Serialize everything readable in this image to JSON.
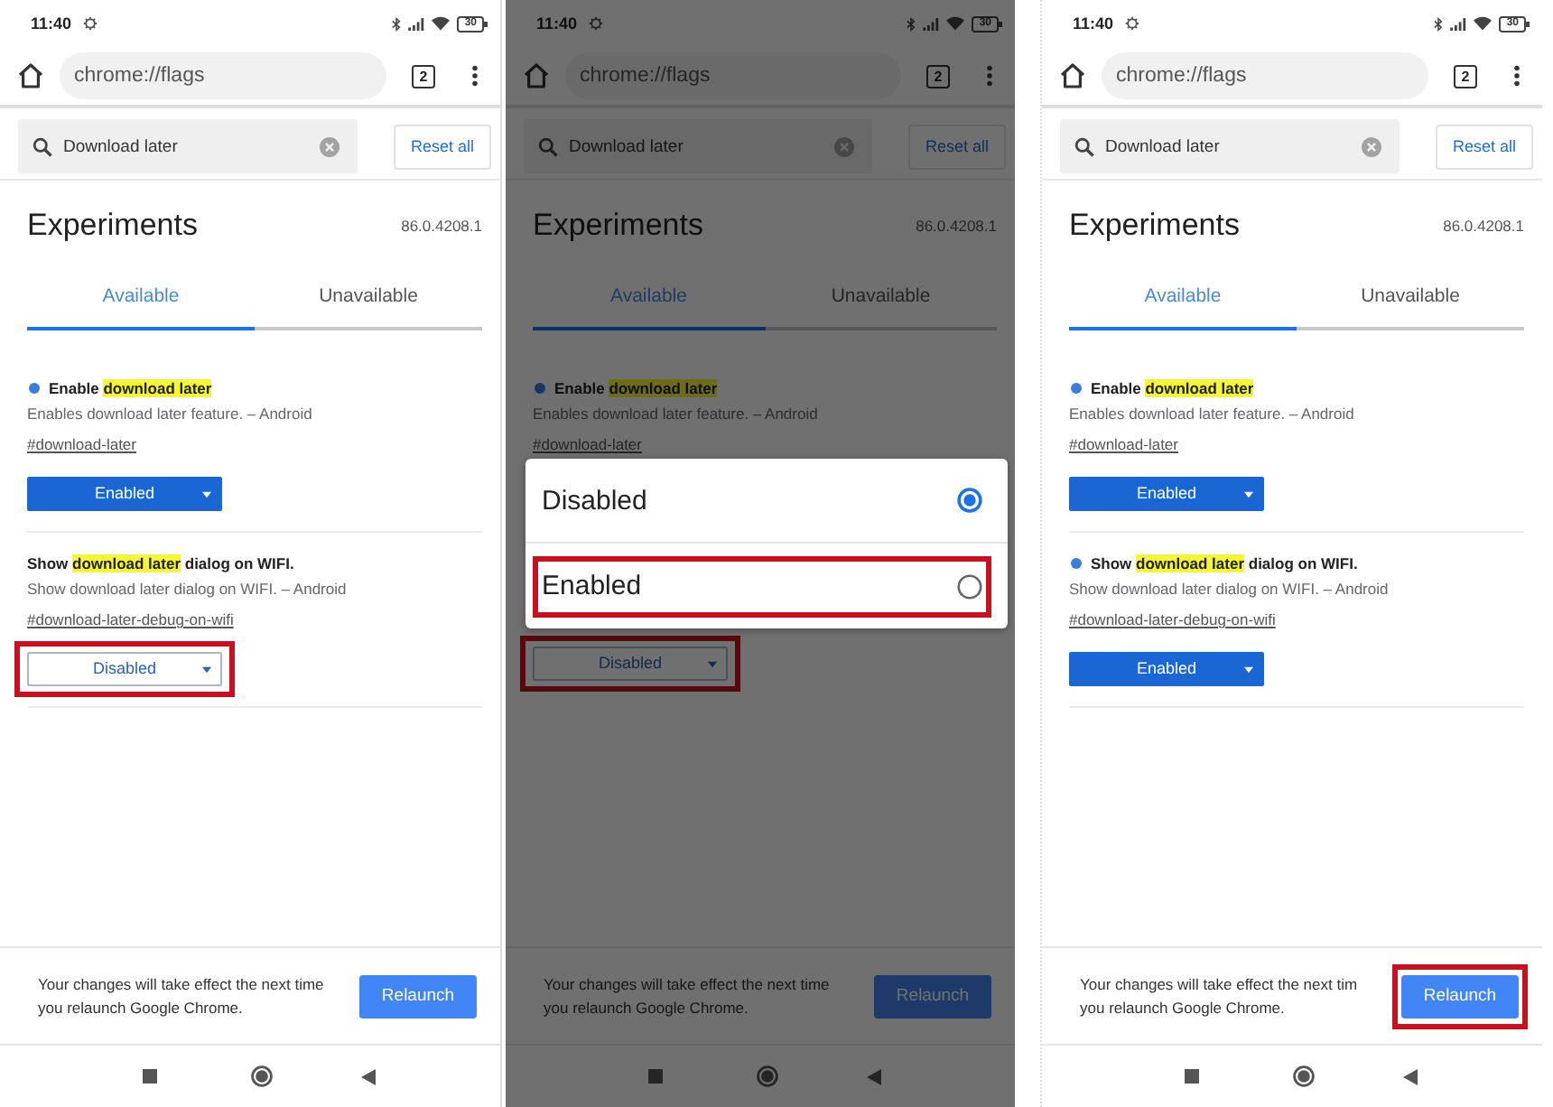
{
  "panels": [
    {
      "status_bar": {
        "time": "11:40",
        "battery": "30"
      },
      "address_bar": {
        "url": "chrome://flags",
        "tab_count": "2"
      },
      "search": {
        "value": "Download later",
        "reset_label": "Reset all"
      },
      "header": {
        "title": "Experiments",
        "version": "86.0.4208.1"
      },
      "tabs": [
        {
          "label": "Available",
          "selected": true
        },
        {
          "label": "Unavailable",
          "selected": false
        }
      ],
      "flags": [
        {
          "modified": true,
          "title": [
            {
              "text": "Enable ",
              "highlight": false
            },
            {
              "text": "download later",
              "highlight": true
            }
          ],
          "description": "Enables download later feature. – Android",
          "link": "#download-later",
          "select": {
            "value": "Enabled",
            "highlighted": false
          }
        },
        {
          "modified": false,
          "title": [
            {
              "text": "Show ",
              "highlight": false
            },
            {
              "text": "download later",
              "highlight": true
            },
            {
              "text": " dialog on WIFI.",
              "highlight": false
            }
          ],
          "description": "Show download later dialog on WIFI. – Android",
          "link": "#download-later-debug-on-wifi",
          "select": {
            "value": "Disabled",
            "highlighted": true
          }
        }
      ],
      "relaunch": {
        "message_lines": [
          "Your changes will take effect the next time",
          "you relaunch Google Chrome."
        ],
        "button": "Relaunch",
        "highlighted": false
      },
      "dimmed": false
    },
    {
      "status_bar": {
        "time": "11:40",
        "battery": "30"
      },
      "address_bar": {
        "url": "chrome://flags",
        "tab_count": "2"
      },
      "search": {
        "value": "Download later",
        "reset_label": "Reset all"
      },
      "header": {
        "title": "Experiments",
        "version": "86.0.4208.1"
      },
      "tabs": [
        {
          "label": "Available",
          "selected": true
        },
        {
          "label": "Unavailable",
          "selected": false
        }
      ],
      "flags": [
        {
          "modified": true,
          "title": [
            {
              "text": "Enable ",
              "highlight": false
            },
            {
              "text": "download later",
              "highlight": true
            }
          ],
          "description": "Enables download later feature. – Android",
          "link": "#download-later"
        },
        {
          "modified": false,
          "dialog": {
            "options": [
              {
                "label": "Disabled",
                "selected": true,
                "highlighted": false
              },
              {
                "label": "Enabled",
                "selected": false,
                "highlighted": true
              }
            ]
          },
          "select": {
            "value": "Disabled",
            "highlighted": true
          }
        }
      ],
      "relaunch": {
        "message_lines": [
          "Your changes will take effect the next time",
          "you relaunch Google Chrome."
        ],
        "button": "Relaunch",
        "highlighted": false
      },
      "dimmed": true
    },
    {
      "status_bar": {
        "time": "11:40",
        "battery": "30"
      },
      "address_bar": {
        "url": "chrome://flags",
        "tab_count": "2"
      },
      "search": {
        "value": "Download later",
        "reset_label": "Reset all"
      },
      "header": {
        "title": "Experiments",
        "version": "86.0.4208.1"
      },
      "tabs": [
        {
          "label": "Available",
          "selected": true
        },
        {
          "label": "Unavailable",
          "selected": false
        }
      ],
      "flags": [
        {
          "modified": true,
          "title": [
            {
              "text": "Enable ",
              "highlight": false
            },
            {
              "text": "download later",
              "highlight": true
            }
          ],
          "description": "Enables download later feature. – Android",
          "link": "#download-later",
          "select": {
            "value": "Enabled",
            "highlighted": false
          }
        },
        {
          "modified": true,
          "title": [
            {
              "text": "Show ",
              "highlight": false
            },
            {
              "text": "download later",
              "highlight": true
            },
            {
              "text": " dialog on WIFI.",
              "highlight": false
            }
          ],
          "description": "Show download later dialog on WIFI. – Android",
          "link": "#download-later-debug-on-wifi",
          "select": {
            "value": "Enabled",
            "highlighted": false
          }
        }
      ],
      "relaunch": {
        "message_lines": [
          "Your changes will take effect the next tim",
          "you relaunch Google Chrome."
        ],
        "button": "Relaunch",
        "highlighted": true
      },
      "dimmed": false
    }
  ]
}
